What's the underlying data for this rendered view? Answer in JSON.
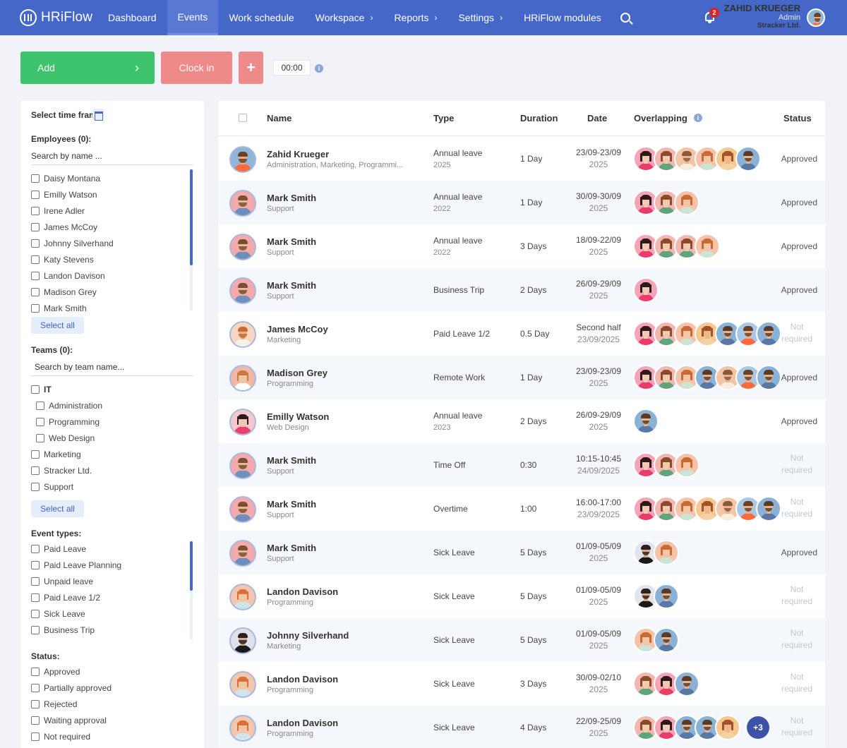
{
  "app": {
    "name": "HRiFlow"
  },
  "nav": {
    "items": [
      {
        "label": "Dashboard",
        "chevron": false,
        "active": false
      },
      {
        "label": "Events",
        "chevron": false,
        "active": true
      },
      {
        "label": "Work schedule",
        "chevron": false,
        "active": false
      },
      {
        "label": "Workspace",
        "chevron": true,
        "active": false
      },
      {
        "label": "Reports",
        "chevron": true,
        "active": false
      },
      {
        "label": "Settings",
        "chevron": true,
        "active": false
      },
      {
        "label": "HRiFlow modules",
        "chevron": false,
        "active": false
      }
    ],
    "notification_count": "2",
    "chevron_glyph": "›"
  },
  "user": {
    "name": "ZAHID KRUEGER",
    "role": "Admin",
    "company": "Stracker Ltd."
  },
  "toolbar": {
    "add_label": "Add",
    "add_chevron": "›",
    "clock_in_label": "Clock in",
    "plus_label": "+",
    "timer": "00:00",
    "info": "i"
  },
  "filters": {
    "time_frame_label": "Select time frame:",
    "employees_label": "Employees (0):",
    "employees_placeholder": "Search by name ...",
    "employees": [
      "Daisy Montana",
      "Emilly Watson",
      "Irene Adler",
      "James McCoy",
      "Johnny Silverhand",
      "Katy Stevens",
      "Landon Davison",
      "Madison Grey",
      "Mark Smith"
    ],
    "select_all": "Select all",
    "teams_label": "Teams (0):",
    "teams_placeholder": "Search by team name...",
    "teams": [
      {
        "label": "IT",
        "bold": true,
        "indent": false
      },
      {
        "label": "Administration",
        "bold": false,
        "indent": true
      },
      {
        "label": "Programming",
        "bold": false,
        "indent": true
      },
      {
        "label": "Web Design",
        "bold": false,
        "indent": true
      },
      {
        "label": "Marketing",
        "bold": false,
        "indent": false
      },
      {
        "label": "Stracker Ltd.",
        "bold": false,
        "indent": false
      },
      {
        "label": "Support",
        "bold": false,
        "indent": false
      }
    ],
    "event_types_label": "Event types:",
    "event_types": [
      "Paid Leave",
      "Paid Leave Planning",
      "Unpaid leave",
      "Paid Leave 1/2",
      "Sick Leave",
      "Business Trip"
    ],
    "status_label": "Status:",
    "statuses": [
      "Approved",
      "Partially approved",
      "Rejected",
      "Waiting approval",
      "Not required"
    ]
  },
  "table": {
    "headers": {
      "name": "Name",
      "type": "Type",
      "duration": "Duration",
      "date": "Date",
      "overlapping": "Overlapping",
      "status": "Status"
    },
    "rows": [
      {
        "name": "Zahid Krueger",
        "dept": "Administration, Marketing, Programmi...",
        "type": "Annual leave",
        "type_year": "2025",
        "duration": "1 Day",
        "date1": "23/09-23/09",
        "date2": "2025",
        "status": "Approved",
        "not_required": false,
        "avatar": "zahid",
        "overlap": [
          "p",
          "g",
          "b",
          "m",
          "o",
          "t"
        ],
        "more": ""
      },
      {
        "name": "Mark Smith",
        "dept": "Support",
        "type": "Annual leave",
        "type_year": "2022",
        "duration": "1 Day",
        "date1": "30/09-30/09",
        "date2": "2025",
        "status": "Approved",
        "not_required": false,
        "avatar": "mark",
        "overlap": [
          "p",
          "g",
          "m"
        ],
        "more": ""
      },
      {
        "name": "Mark Smith",
        "dept": "Support",
        "type": "Annual leave",
        "type_year": "2022",
        "duration": "3 Days",
        "date1": "18/09-22/09",
        "date2": "2025",
        "status": "Approved",
        "not_required": false,
        "avatar": "mark",
        "overlap": [
          "p",
          "g",
          "g",
          "m"
        ],
        "more": ""
      },
      {
        "name": "Mark Smith",
        "dept": "Support",
        "type": "Business Trip",
        "type_year": "",
        "duration": "2 Days",
        "date1": "26/09-29/09",
        "date2": "2025",
        "status": "Approved",
        "not_required": false,
        "avatar": "mark",
        "overlap": [
          "p"
        ],
        "more": ""
      },
      {
        "name": "James McCoy",
        "dept": "Marketing",
        "type": "Paid Leave 1/2",
        "type_year": "",
        "duration": "0.5 Day",
        "date1": "Second half",
        "date2": "23/09/2025",
        "status": "Not required",
        "not_required": true,
        "avatar": "james",
        "overlap": [
          "p",
          "g",
          "m",
          "o",
          "t",
          "z",
          "t"
        ],
        "more": ""
      },
      {
        "name": "Madison Grey",
        "dept": "Programming",
        "type": "Remote Work",
        "type_year": "",
        "duration": "1 Day",
        "date1": "23/09-23/09",
        "date2": "2025",
        "status": "Approved",
        "not_required": false,
        "avatar": "madison",
        "overlap": [
          "p",
          "g",
          "m",
          "t",
          "b",
          "z",
          "t"
        ],
        "more": ""
      },
      {
        "name": "Emilly Watson",
        "dept": "Web Design",
        "type": "Annual leave",
        "type_year": "2023",
        "duration": "2 Days",
        "date1": "26/09-29/09",
        "date2": "2025",
        "status": "Approved",
        "not_required": false,
        "avatar": "emilly",
        "overlap": [
          "t"
        ],
        "more": ""
      },
      {
        "name": "Mark Smith",
        "dept": "Support",
        "type": "Time Off",
        "type_year": "",
        "duration": "0:30",
        "date1": "10:15-10:45",
        "date2": "24/09/2025",
        "status": "Not required",
        "not_required": true,
        "avatar": "mark",
        "overlap": [
          "p",
          "g",
          "m"
        ],
        "more": ""
      },
      {
        "name": "Mark Smith",
        "dept": "Support",
        "type": "Overtime",
        "type_year": "",
        "duration": "1:00",
        "date1": "16:00-17:00",
        "date2": "23/09/2025",
        "status": "Not required",
        "not_required": true,
        "avatar": "mark",
        "overlap": [
          "p",
          "g",
          "m",
          "o",
          "b",
          "z",
          "t"
        ],
        "more": ""
      },
      {
        "name": "Mark Smith",
        "dept": "Support",
        "type": "Sick Leave",
        "type_year": "",
        "duration": "5 Days",
        "date1": "01/09-05/09",
        "date2": "2025",
        "status": "Approved",
        "not_required": false,
        "avatar": "mark",
        "overlap": [
          "s",
          "m"
        ],
        "more": ""
      },
      {
        "name": "Landon Davison",
        "dept": "Programming",
        "type": "Sick Leave",
        "type_year": "",
        "duration": "5 Days",
        "date1": "01/09-05/09",
        "date2": "2025",
        "status": "Not required",
        "not_required": true,
        "avatar": "landon",
        "overlap": [
          "s",
          "t"
        ],
        "more": ""
      },
      {
        "name": "Johnny Silverhand",
        "dept": "Marketing",
        "type": "Sick Leave",
        "type_year": "",
        "duration": "5 Days",
        "date1": "01/09-05/09",
        "date2": "2025",
        "status": "Not required",
        "not_required": true,
        "avatar": "johnny",
        "overlap": [
          "m",
          "t"
        ],
        "more": ""
      },
      {
        "name": "Landon Davison",
        "dept": "Programming",
        "type": "Sick Leave",
        "type_year": "",
        "duration": "3 Days",
        "date1": "30/09-02/10",
        "date2": "2025",
        "status": "Not required",
        "not_required": true,
        "avatar": "landon",
        "overlap": [
          "g",
          "p",
          "t"
        ],
        "more": ""
      },
      {
        "name": "Landon Davison",
        "dept": "Programming",
        "type": "Sick Leave",
        "type_year": "",
        "duration": "4 Days",
        "date1": "22/09-25/09",
        "date2": "2025",
        "status": "Not required",
        "not_required": true,
        "avatar": "landon",
        "overlap": [
          "g",
          "p",
          "t",
          "t",
          "o"
        ],
        "more": "+3"
      }
    ]
  }
}
